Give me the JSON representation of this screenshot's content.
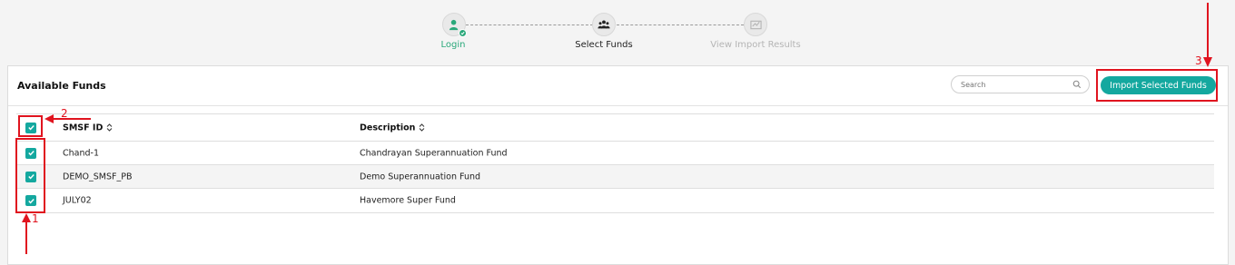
{
  "stepper": {
    "steps": [
      {
        "label": "Login",
        "state": "completed",
        "icon": "user-check-icon",
        "color": "#2aa87a"
      },
      {
        "label": "Select Funds",
        "state": "active",
        "icon": "group-icon",
        "color": "#222222"
      },
      {
        "label": "View Import Results",
        "state": "pending",
        "icon": "chart-icon",
        "color": "#b5b5b5"
      }
    ]
  },
  "panel": {
    "title": "Available Funds",
    "search": {
      "placeholder": "Search",
      "value": ""
    },
    "import_button": "Import Selected Funds"
  },
  "table": {
    "columns": [
      "SMSF ID",
      "Description"
    ],
    "select_all_checked": true,
    "rows": [
      {
        "smsf_id": "Chand-1",
        "description": "Chandrayan Superannuation Fund",
        "checked": true
      },
      {
        "smsf_id": "DEMO_SMSF_PB",
        "description": "Demo Superannuation Fund",
        "checked": true
      },
      {
        "smsf_id": "JULY02",
        "description": "Havemore Super Fund",
        "checked": true
      }
    ]
  },
  "annotations": {
    "labels": [
      "1",
      "2",
      "3"
    ],
    "color": "#e0141f"
  },
  "colors": {
    "accent": "#14a89f",
    "success": "#2aa87a"
  }
}
